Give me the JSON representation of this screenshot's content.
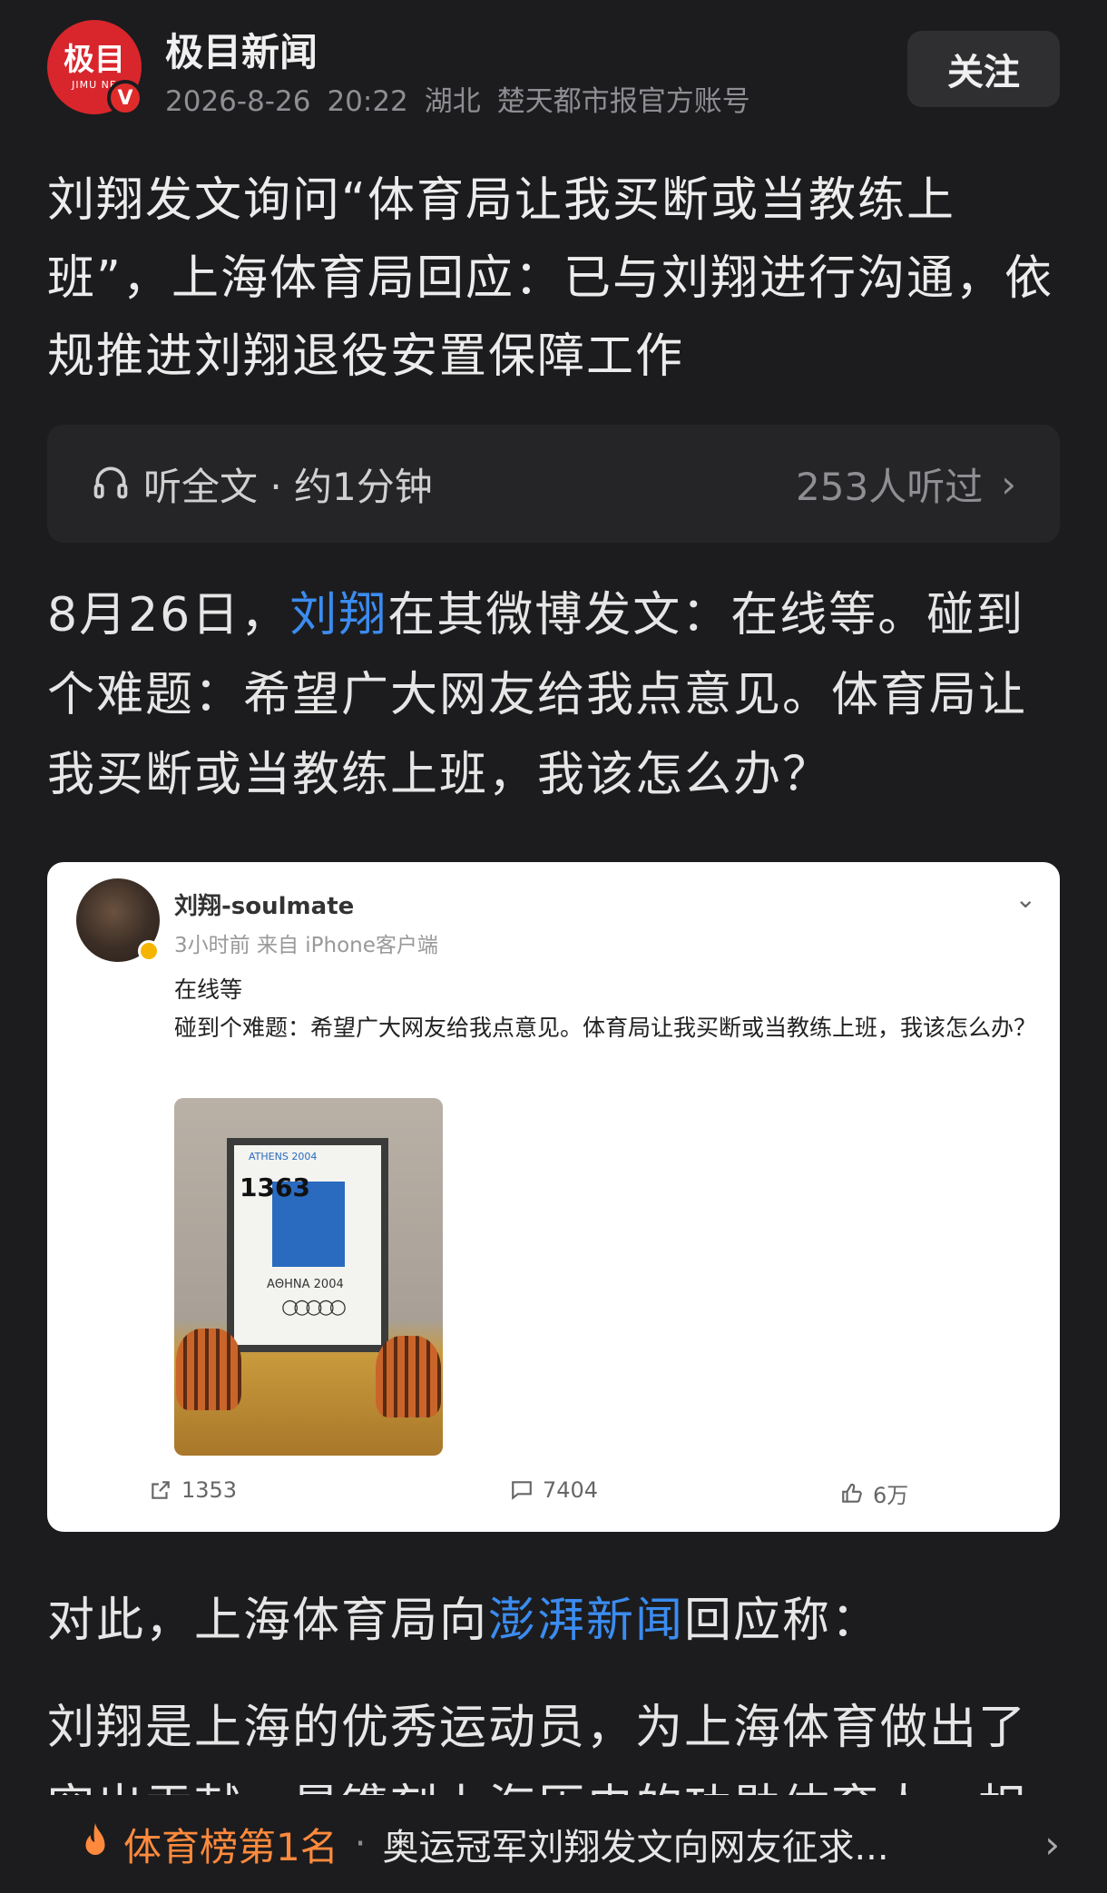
{
  "header": {
    "avatar_text": "极目",
    "avatar_sub": "JIMU NE",
    "source_name": "极目新闻",
    "date": "2026-8-26",
    "time": "20:22",
    "region": "湖北",
    "account_desc": "楚天都市报官方账号",
    "follow_label": "关注"
  },
  "article": {
    "title": "刘翔发文询问“体育局让我买断或当教练上班”，上海体育局回应：已与刘翔进行沟通，依规推进刘翔退役安置保障工作",
    "listen": {
      "label": "听全文 · 约1分钟",
      "count": "253人听过",
      "icon": "headphones-icon"
    },
    "para1": {
      "prefix": "8月26日，",
      "link": "刘翔",
      "suffix": "在其微博发文：在线等。碰到个难题：希望广大网友给我点意见。体育局让我买断或当教练上班，我该怎么办？"
    },
    "para2": {
      "prefix": "对此，上海体育局向",
      "link": "澎湃新闻",
      "suffix": "回应称："
    },
    "para3": "刘翔是上海的优秀运动员，为上海体育做出了突出贡献，是镌刻上海历史的功勋体育人。相"
  },
  "weibo_card": {
    "username": "刘翔-soulmate",
    "meta": "3小时前 来自 iPhone客户端",
    "text_line1": "在线等",
    "text_line2": "碰到个难题：希望广大网友给我点意见。体育局让我买断或当教练上班，我该怎么办？",
    "photo": {
      "athens_label": "ATHENS 2004",
      "bib": "1363",
      "athna_label": "AΘHNA 2004"
    },
    "stats": {
      "share": "1353",
      "comment": "7404",
      "like": "6万"
    }
  },
  "bottom_bar": {
    "rank": "体育榜第1名",
    "separator": "·",
    "headline": "奥运冠军刘翔发文向网友征求...",
    "accent_color": "#ff8a3d"
  }
}
